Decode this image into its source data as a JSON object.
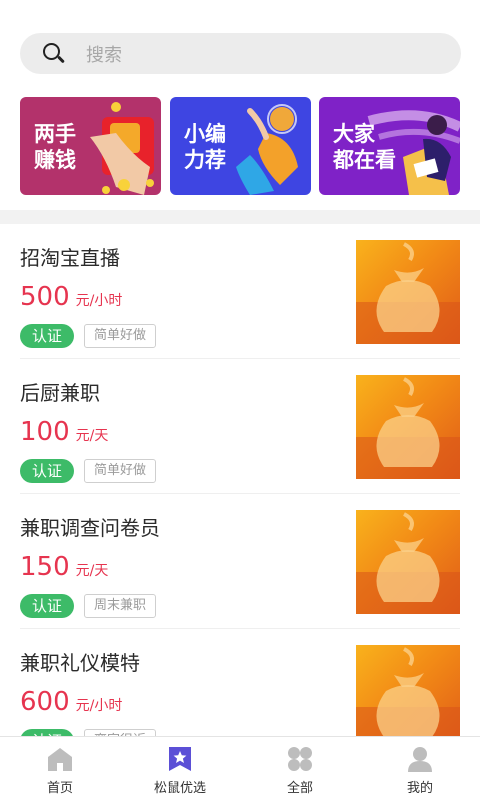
{
  "search": {
    "placeholder": "搜索"
  },
  "banners": [
    {
      "line1": "两手",
      "line2": "赚钱"
    },
    {
      "line1": "小编",
      "line2": "力荐"
    },
    {
      "line1": "大家",
      "line2": "都在看"
    }
  ],
  "jobs": [
    {
      "title": "招淘宝直播",
      "amount": "500",
      "unit": "元/小时",
      "verified": "认证",
      "tag": "简单好做"
    },
    {
      "title": "后厨兼职",
      "amount": "100",
      "unit": "元/天",
      "verified": "认证",
      "tag": "简单好做"
    },
    {
      "title": "兼职调查问卷员",
      "amount": "150",
      "unit": "元/天",
      "verified": "认证",
      "tag": "周末兼职"
    },
    {
      "title": "兼职礼仪模特",
      "amount": "600",
      "unit": "元/小时",
      "verified": "认证",
      "tag": "离家很近"
    }
  ],
  "tabbar": [
    {
      "label": "首页",
      "icon": "home-icon"
    },
    {
      "label": "松鼠优选",
      "icon": "star-bookmark-icon"
    },
    {
      "label": "全部",
      "icon": "grid-icon"
    },
    {
      "label": "我的",
      "icon": "user-icon"
    }
  ],
  "colors": {
    "accent_red": "#e6344f",
    "verified_green": "#3dbb68",
    "selected_tab": "#5b4fd6"
  }
}
